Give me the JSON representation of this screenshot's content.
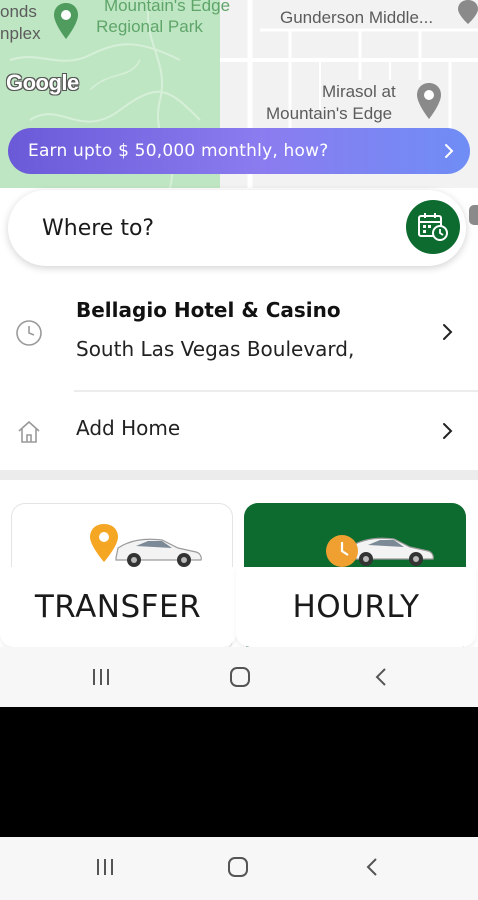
{
  "map": {
    "labels": {
      "complex_top": "onds",
      "complex_bottom": "nplex",
      "park_top": "Mountain's Edge",
      "park_bottom": "Regional Park",
      "school": "Gunderson Middle...",
      "poi_top": "Mirasol at",
      "poi_bottom": "Mountain's Edge"
    },
    "logo": "Google",
    "colors": {
      "park": "#bfe6c3",
      "land": "#f2f2f2",
      "road": "#ffffff"
    }
  },
  "promo": {
    "text": "Earn upto $ 50,000 monthly, how?",
    "chevron": "chevron-right-icon",
    "gradient": [
      "#6a5ad8",
      "#8b7cf0",
      "#6f8df5"
    ]
  },
  "search": {
    "prompt": "Where to?",
    "schedule_icon": "calendar-clock-icon",
    "accent": "#0d6b2f"
  },
  "recent": [
    {
      "icon": "clock-icon",
      "title": "Bellagio Hotel & Casino",
      "subtitle": "South Las Vegas Boulevard,"
    }
  ],
  "saved": [
    {
      "icon": "home-icon",
      "label": "Add Home"
    }
  ],
  "services": [
    {
      "label": "TRANSFER",
      "icon": "car-location-pin-icon",
      "selected": false
    },
    {
      "label": "HOURLY",
      "icon": "car-clock-icon",
      "selected": true
    }
  ],
  "system_nav": {
    "buttons": [
      "recent-apps-icon",
      "home-circle-icon",
      "back-icon"
    ]
  }
}
